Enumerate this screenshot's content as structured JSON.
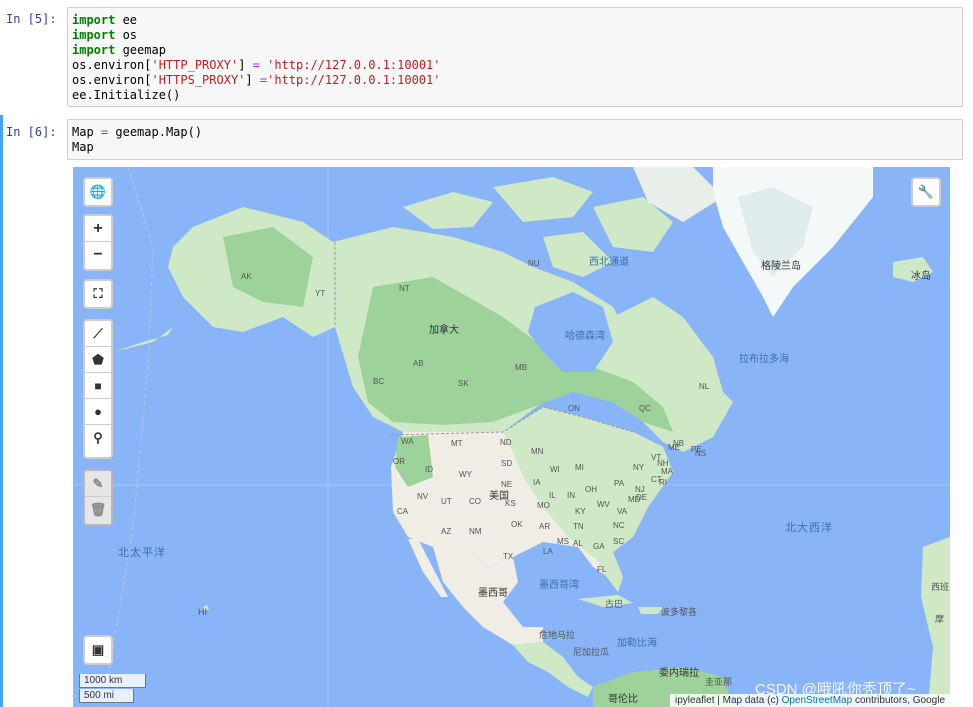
{
  "cells": [
    {
      "prompt": "In  [5]:",
      "lines": [
        [
          {
            "t": "import",
            "c": "kw"
          },
          {
            "t": " ee"
          }
        ],
        [
          {
            "t": "import",
            "c": "kw"
          },
          {
            "t": " os"
          }
        ],
        [
          {
            "t": "import",
            "c": "kw"
          },
          {
            "t": " geemap"
          }
        ],
        [
          {
            "t": "os.environ["
          },
          {
            "t": "'HTTP_PROXY'",
            "c": "str"
          },
          {
            "t": "] "
          },
          {
            "t": "=",
            "c": "op"
          },
          {
            "t": " "
          },
          {
            "t": "'http://127.0.0.1:10001'",
            "c": "str"
          }
        ],
        [
          {
            "t": "os.environ["
          },
          {
            "t": "'HTTPS_PROXY'",
            "c": "str"
          },
          {
            "t": "] "
          },
          {
            "t": "=",
            "c": "op"
          },
          {
            "t": "'http://127.0.0.1:10001'",
            "c": "str"
          }
        ],
        [
          {
            "t": "ee.Initialize()"
          }
        ]
      ]
    },
    {
      "prompt": "In  [6]:",
      "lines": [
        [
          {
            "t": "Map "
          },
          {
            "t": "=",
            "c": "op"
          },
          {
            "t": " geemap.Map()"
          }
        ],
        [
          {
            "t": "Map"
          }
        ]
      ]
    }
  ],
  "map": {
    "labels": {
      "canada": "加拿大",
      "usa": "美国",
      "mexico": "墨西哥",
      "greenland": "格陵兰岛",
      "iceland": "冰岛",
      "hudson_bay": "哈德森湾",
      "labrador_sea": "拉布拉多海",
      "north_atlantic": "北大西洋",
      "north_pacific": "北太平洋",
      "gulf_mexico": "墨西哥湾",
      "caribbean": "加勒比海",
      "cuba": "古巴",
      "bahamas": "波多黎各",
      "guatemala": "危地马拉",
      "honduras": "尼加拉瓜",
      "venezuela": "委内瑞拉",
      "guyana": "圭亚那",
      "colombia": "哥伦比",
      "spain": "西班",
      "morocco": "摩",
      "nw_passage": "西北通道",
      "hawaii": "HI"
    },
    "states": [
      "AK",
      "YT",
      "NT",
      "NU",
      "BC",
      "AB",
      "SK",
      "MB",
      "ON",
      "QC",
      "NL",
      "NB",
      "NS",
      "PE",
      "WA",
      "MT",
      "ND",
      "MN",
      "WI",
      "MI",
      "NY",
      "VT",
      "ME",
      "NH",
      "MA",
      "OR",
      "ID",
      "WY",
      "SD",
      "NE",
      "IA",
      "IL",
      "IN",
      "OH",
      "PA",
      "NJ",
      "CT",
      "RI",
      "CA",
      "NV",
      "UT",
      "CO",
      "KS",
      "MO",
      "KY",
      "WV",
      "VA",
      "MD",
      "DE",
      "AZ",
      "NM",
      "OK",
      "AR",
      "TN",
      "NC",
      "SC",
      "TX",
      "LA",
      "MS",
      "AL",
      "GA",
      "FL"
    ],
    "scale": {
      "km": "1000 km",
      "mi": "500 mi"
    },
    "attribution": {
      "pre": "ipyleaflet | Map data (c) ",
      "link": "OpenStreetMap",
      "post": " contributors, Google"
    },
    "watermark": "CSDN @哦吼你秃顶了~"
  },
  "colors": {
    "ocean": "#8ab4f8",
    "land": "#cfe9c7",
    "forest": "#9dd29a",
    "arid": "#f0ede4",
    "ice": "#f4f8f8",
    "accent": "#42a5f5"
  }
}
